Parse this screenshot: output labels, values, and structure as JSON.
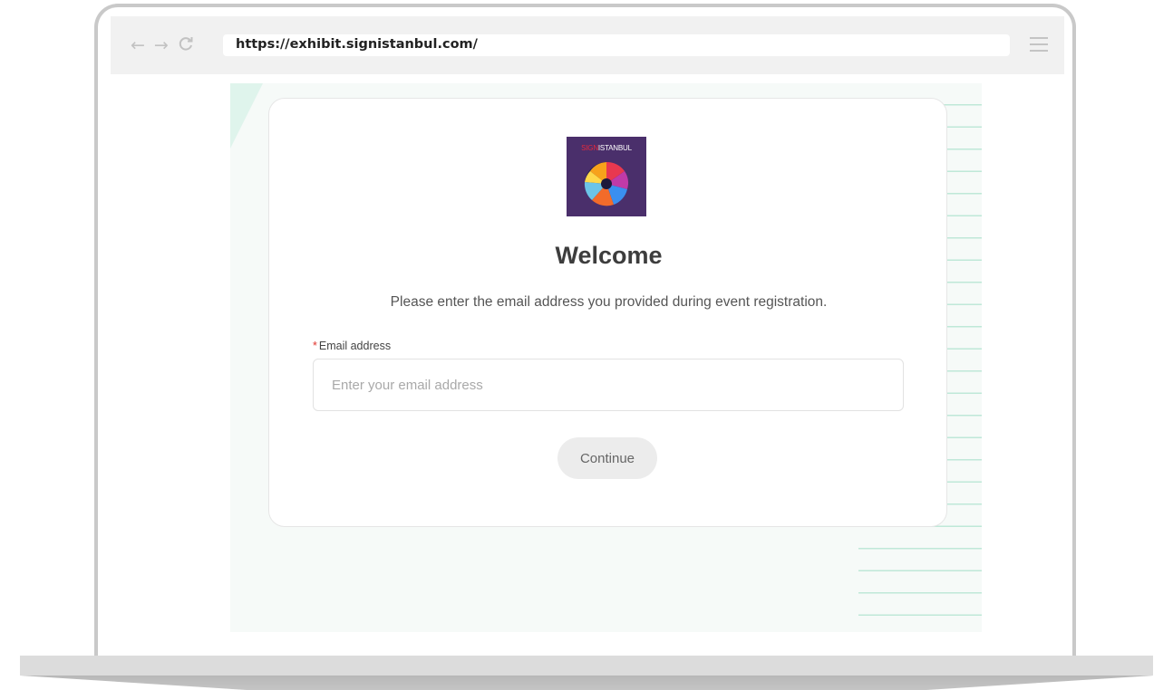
{
  "browser": {
    "url": "https://exhibit.signistanbul.com/",
    "icons": [
      "back-arrow-icon",
      "forward-arrow-icon",
      "reload-icon",
      "hamburger-menu-icon"
    ]
  },
  "logo": {
    "brand_red": "SIGN",
    "brand_white": "ISTANBUL"
  },
  "login": {
    "title": "Welcome",
    "subtitle": "Please enter the email address you provided during event registration.",
    "required_mark": "*",
    "email_label": "Email address",
    "email_placeholder": "Enter your email address",
    "email_value": "",
    "continue_label": "Continue"
  },
  "colors": {
    "accent_green": "#bfe8d8",
    "required_red": "#e0342c",
    "logo_purple": "#4a2f6b"
  }
}
